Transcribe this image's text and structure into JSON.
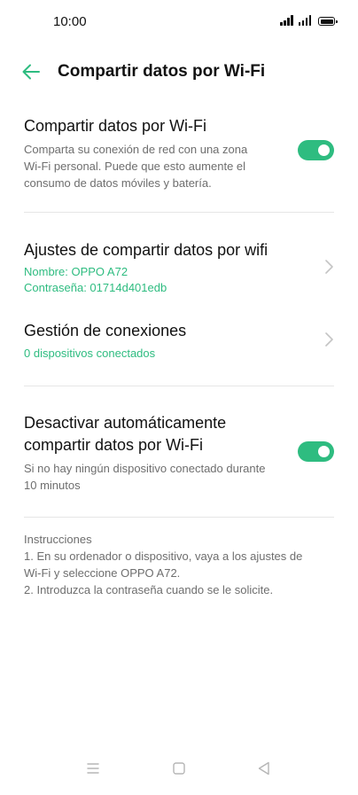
{
  "status_bar": {
    "time": "10:00"
  },
  "header": {
    "title": "Compartir datos por Wi-Fi"
  },
  "wifi_sharing": {
    "title": "Compartir datos por Wi-Fi",
    "description_lines": [
      "Comparta su conexión de red con una zona",
      "Wi-Fi personal. Puede que esto aumente el",
      "consumo de datos móviles y batería."
    ],
    "toggle_on": true
  },
  "hotspot_settings": {
    "title": "Ajustes de compartir datos por wifi",
    "name": "Nombre: OPPO A72",
    "password": "Contraseña: 01714d401edb"
  },
  "connection_management": {
    "title": "Gestión de conexiones",
    "status": "0 dispositivos conectados"
  },
  "auto_disable": {
    "title_lines": [
      "Desactivar automáticamente",
      "compartir datos por Wi-Fi"
    ],
    "description_lines": [
      "Si no hay ningún dispositivo conectado durante",
      "10 minutos"
    ],
    "toggle_on": true
  },
  "instructions": {
    "heading": "Instrucciones",
    "lines": [
      "1. En su ordenador o dispositivo, vaya a los ajustes de",
      "Wi-Fi y seleccione OPPO A72.",
      "2. Introduzca la contraseña cuando se le solicite."
    ]
  },
  "nav_bar": {
    "icons": [
      "menu-icon",
      "home-icon",
      "back-icon"
    ]
  },
  "colors": {
    "accent": "#2ebc80",
    "text": "#111111",
    "secondary_text": "#6e6e6e",
    "divider": "#e6e6e6"
  }
}
